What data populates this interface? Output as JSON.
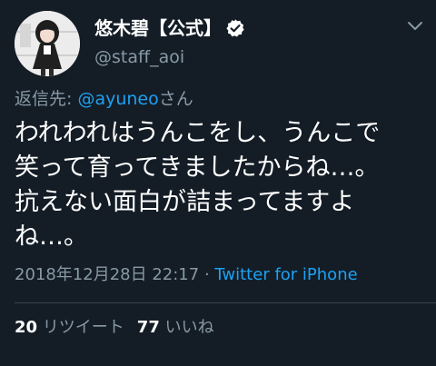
{
  "user": {
    "display_name": "悠木碧【公式】",
    "handle": "@staff_aoi"
  },
  "reply": {
    "prefix": "返信先: ",
    "mention": "@ayuneo",
    "suffix": "さん"
  },
  "tweet": {
    "lines": [
      "われわれはうんこをし、うんこで",
      "笑って育ってきましたからね…。",
      "抗えない面白が詰まってますよ",
      "ね…。"
    ]
  },
  "meta": {
    "timestamp": "2018年12月28日 22:17",
    "separator": " · ",
    "source": "Twitter for iPhone"
  },
  "stats": {
    "retweets_count": "20",
    "retweets_label": "リツイート",
    "likes_count": "77",
    "likes_label": "いいね"
  },
  "colors": {
    "background": "#141d26",
    "text": "#ffffff",
    "secondary": "#8899a6",
    "link": "#1da1f2",
    "divider": "#38444d"
  },
  "icons": {
    "verified": "verified-badge-icon",
    "more": "chevron-down-icon"
  }
}
